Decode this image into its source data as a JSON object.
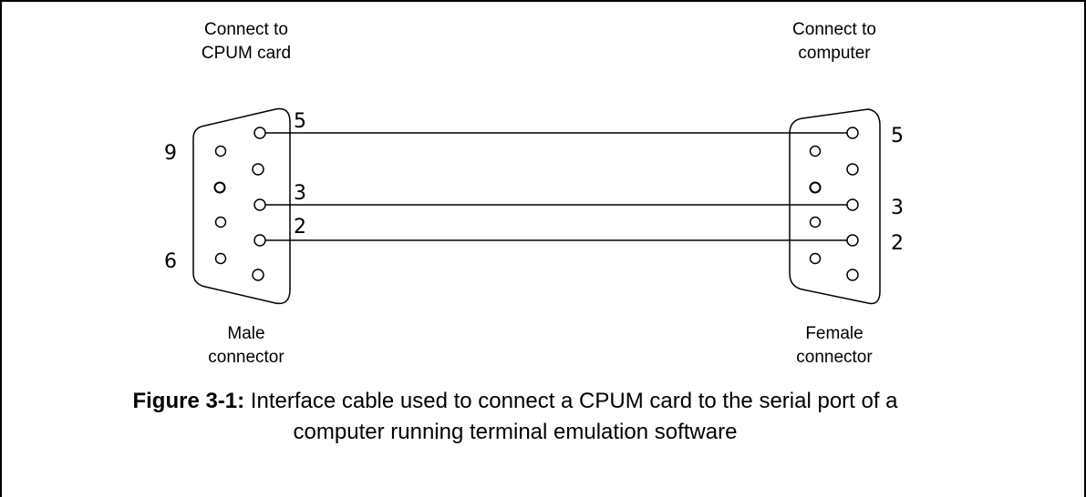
{
  "left_connector": {
    "top_label": [
      "Connect to",
      "CPUM card"
    ],
    "bottom_label": [
      "Male",
      "connector"
    ],
    "pin_numbers": {
      "p5": "5",
      "p9": "9",
      "p3": "3",
      "p2": "2",
      "p6": "6"
    }
  },
  "right_connector": {
    "top_label": [
      "Connect to",
      "computer"
    ],
    "bottom_label": [
      "Female",
      "connector"
    ],
    "pin_numbers": {
      "p5": "5",
      "p3": "3",
      "p2": "2"
    }
  },
  "caption": {
    "figure_label": "Figure 3-1:",
    "text_line1": " Interface cable used to connect a CPUM card to the serial port of a",
    "text_line2": "computer running terminal emulation software"
  }
}
